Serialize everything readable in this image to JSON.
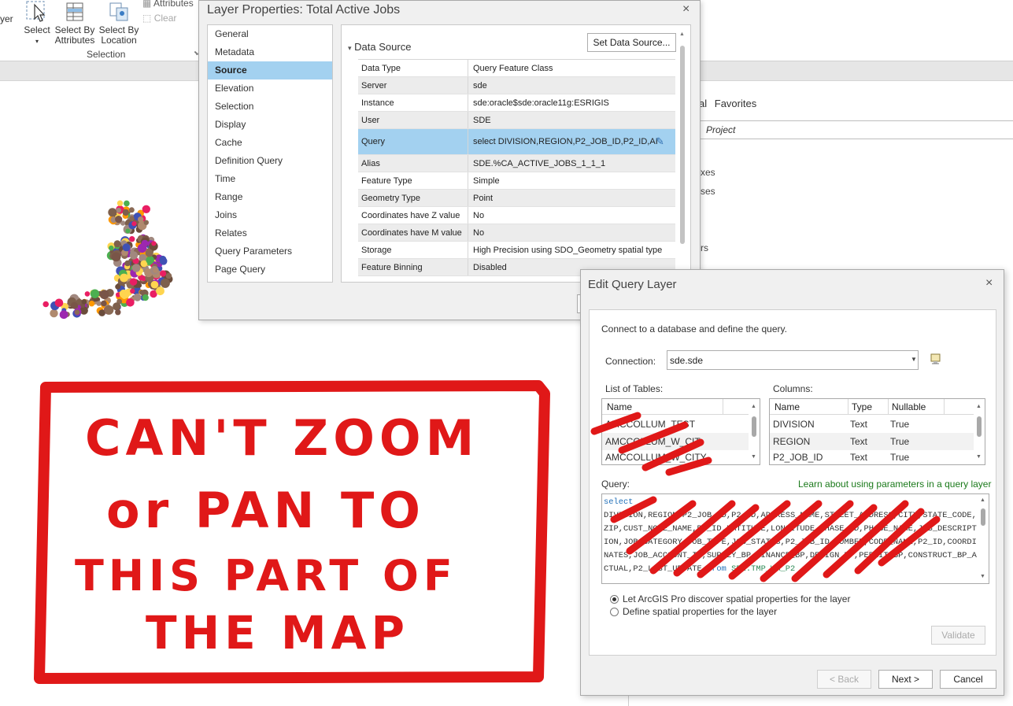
{
  "ribbon": {
    "partial_label": "yer",
    "buttons": [
      {
        "label_line1": "Select",
        "label_line2": ""
      },
      {
        "label_line1": "Select By",
        "label_line2": "Attributes"
      },
      {
        "label_line1": "Select By",
        "label_line2": "Location"
      }
    ],
    "attributes_label": "Attributes",
    "clear_label": "Clear",
    "group_label": "Selection"
  },
  "catalog": {
    "tab_partial": "al",
    "favorites_tab": "Favorites",
    "project_row": "Project",
    "fragments": [
      "xes",
      "ses",
      "rs"
    ]
  },
  "layer_properties": {
    "title": "Layer Properties: Total Active Jobs",
    "close_icon": "×",
    "nav": [
      "General",
      "Metadata",
      "Source",
      "Elevation",
      "Selection",
      "Display",
      "Cache",
      "Definition Query",
      "Time",
      "Range",
      "Joins",
      "Relates",
      "Query Parameters",
      "Page Query"
    ],
    "selected_nav": "Source",
    "section_title": "Data Source",
    "set_data_source_button": "Set Data Source...",
    "rows": [
      {
        "key": "Data Type",
        "value": "Query Feature Class"
      },
      {
        "key": "Server",
        "value": "sde"
      },
      {
        "key": "Instance",
        "value": "sde:oracle$sde:oracle11g:ESRIGIS"
      },
      {
        "key": "User",
        "value": "SDE"
      },
      {
        "key": "Query",
        "value": "select DIVISION,REGION,P2_JOB_ID,P2_ID,AI"
      },
      {
        "key": "Alias",
        "value": "SDE.%CA_ACTIVE_JOBS_1_1_1"
      },
      {
        "key": "Feature Type",
        "value": "Simple"
      },
      {
        "key": "Geometry Type",
        "value": "Point"
      },
      {
        "key": "Coordinates have Z value",
        "value": "No"
      },
      {
        "key": "Coordinates have M value",
        "value": "No"
      },
      {
        "key": "Storage",
        "value": "High Precision using SDO_Geometry spatial type"
      },
      {
        "key": "Feature Binning",
        "value": "Disabled"
      }
    ]
  },
  "edit_query_layer": {
    "title": "Edit Query Layer",
    "close_icon": "×",
    "intro": "Connect to a database and define the query.",
    "connection_label": "Connection:",
    "connection_value": "sde.sde",
    "tables_label": "List of Tables:",
    "tables_header": "Name",
    "tables": [
      "AMCCOLLUM_TEST",
      "AMCCOLLUM_W_CIT",
      "AMCCOLLUM_W_CITY"
    ],
    "columns_label": "Columns:",
    "columns_headers": [
      "Name",
      "Type",
      "Nullable"
    ],
    "columns": [
      {
        "name": "DIVISION",
        "type": "Text",
        "nullable": "True"
      },
      {
        "name": "REGION",
        "type": "Text",
        "nullable": "True"
      },
      {
        "name": "P2_JOB_ID",
        "type": "Text",
        "nullable": "True"
      }
    ],
    "query_label": "Query:",
    "learn_link": "Learn about using parameters in a query layer",
    "query_keyword_select": "select",
    "query_body": "DIVISION,REGION,P2_JOB_ID,P2_ID,ADDRESS_NAME,STREET_ADDRESS,CITY,STATE_CODE,ZIP,CUST_NODE_NAME,P2_ID,LATITUDE,LONGITUDE,PHASE_ID,PHASE_NAME,JOB_DESCRIPTION,JOB_CATEGORY,JOB_TYPE,JOB_STATUS,P2_JOB_ID_NUMBER,CODE_NAME,P2_ID,COORDINATES,JOB_ACCOUNT_ID,SUPPLY_BP,FINANCE_BP,DESIGN_BP,PERMIT_BP,CONSTRUCT_BP_ACTUAL,P2_LAST_UPDATE ",
    "query_keyword_from": "from",
    "query_table": "SDE.TMP_WA_P2",
    "radio_discover": "Let ArcGIS Pro discover spatial properties for the layer",
    "radio_define": "Define spatial properties for the layer",
    "validate_button": "Validate",
    "back_button": "< Back",
    "next_button": "Next >",
    "cancel_button": "Cancel"
  },
  "annotation": {
    "line1": "CAN'T ZOOM",
    "line2": "or PAN TO",
    "line3": "THIS PART OF",
    "line4": "THE MAP",
    "color": "#e01818"
  }
}
